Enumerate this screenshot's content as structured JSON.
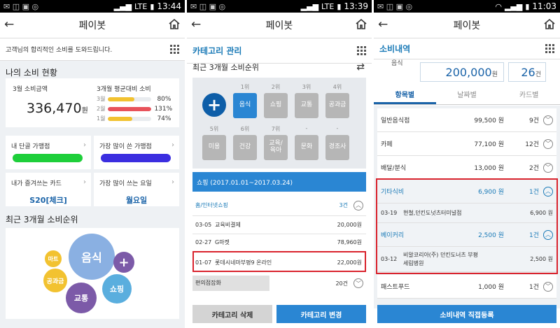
{
  "panel1": {
    "status": {
      "time": "13:44",
      "net": "LTE"
    },
    "title": "페이봇",
    "subtitle": "고객님의 합리적인 소비를 도와드립니다.",
    "section1": "나의 소비 현황",
    "spend3": {
      "label": "3월 소비금액",
      "amount": "336,470",
      "unit": "원"
    },
    "avg": {
      "label": "3개월 평균대비 소비",
      "rows": [
        {
          "month": "3월",
          "pct": "80%",
          "value": 0.61,
          "color": "#f2c230"
        },
        {
          "month": "2월",
          "pct": "131%",
          "value": 1.0,
          "color": "#e8525a"
        },
        {
          "month": "1월",
          "pct": "74%",
          "value": 0.56,
          "color": "#f2c230"
        }
      ]
    },
    "tiles": [
      {
        "label": "내 단골 가맹점",
        "value": ""
      },
      {
        "label": "가장 많이 쓴 가맹점",
        "value": ""
      },
      {
        "label": "내가 즐겨쓰는 카드",
        "value": "S20[체크]"
      },
      {
        "label": "가장 많이 쓰는 요일",
        "value": "월요일"
      }
    ],
    "section2": "최근 3개월 소비순위",
    "bubbles": {
      "food": "음식",
      "mart": "마트",
      "public": "공과금",
      "plus": "+",
      "traffic": "교통",
      "shopping": "쇼핑"
    }
  },
  "panel2": {
    "status": {
      "time": "13:39",
      "net": "LTE"
    },
    "title": "페이봇",
    "subtitle": "카테고리 관리",
    "heading": "최근 3개월 소비순위",
    "ranks_row1": [
      "1위",
      "2위",
      "3위",
      "4위"
    ],
    "cats_row1": [
      "음식",
      "쇼핑",
      "교통",
      "공과금"
    ],
    "ranks_row2": [
      "5위",
      "6위",
      "7위",
      "-",
      "-"
    ],
    "cats_row2": [
      "미용",
      "건강",
      "교육/\n육아",
      "문화",
      "경조사"
    ],
    "period": "쇼핑 (2017.01.01~2017.03.24)",
    "group": {
      "name": "홈/인터넷쇼핑",
      "count": "3건"
    },
    "items": [
      {
        "date": "03-05",
        "name": "교육비결제",
        "amount": "20,000원"
      },
      {
        "date": "02-27",
        "name": "G마켓",
        "amount": "78,960원"
      },
      {
        "date": "01-07",
        "name": "롯데시네마부평9 온라인",
        "amount": "22,000원"
      }
    ],
    "group2": {
      "name": "편의점잡화",
      "count": "20건"
    },
    "btn_delete": "카테고리 삭제",
    "btn_change": "카테고리 변경"
  },
  "panel3": {
    "status": {
      "time": "11:03"
    },
    "title": "페이봇",
    "subtitle": "소비내역",
    "top": {
      "label": "음식",
      "amount": "200,000",
      "unit": "원",
      "days": "26",
      "dunit": "건"
    },
    "tabs": [
      "항목별",
      "날짜별",
      "카드별"
    ],
    "rows": [
      {
        "name": "일반음식점",
        "amount": "99,500 원",
        "count": "9건"
      },
      {
        "name": "카페",
        "amount": "77,100 원",
        "count": "12건"
      },
      {
        "name": "배달/분식",
        "amount": "13,000 원",
        "count": "2건"
      }
    ],
    "group1": {
      "name": "기타식비",
      "amount": "6,900 원",
      "count": "1건"
    },
    "sub1": {
      "date": "03-19",
      "name": "현철,던킨도넛츠터미널점",
      "amount": "6,900 원"
    },
    "group2": {
      "name": "베이커리",
      "amount": "2,500 원",
      "count": "1건"
    },
    "sub2": {
      "date": "03-12",
      "name": "비알코리아(주) 던킨도너츠 부평\n세림병원",
      "amount": "2,500 원"
    },
    "row_last": {
      "name": "패스트푸드",
      "amount": "1,000 원",
      "count": "1건"
    },
    "btn": "소비내역 직접등록"
  },
  "colors": {
    "accent": "#1a7ab7",
    "button": "#2a86d3",
    "highlight": "#d9232d"
  }
}
